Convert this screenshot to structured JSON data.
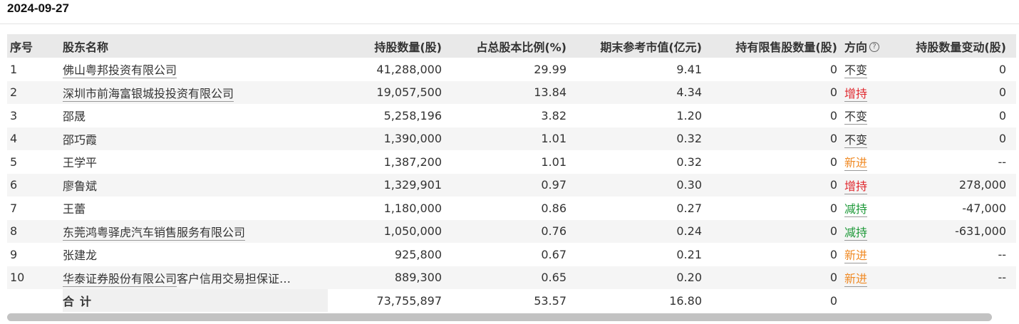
{
  "date": "2024-09-27",
  "headers": {
    "index": "序号",
    "name": "股东名称",
    "shares": "持股数量(股)",
    "ratio": "占总股本比例(%)",
    "market_value": "期末参考市值(亿元)",
    "restricted": "持有限售股数量(股)",
    "direction": "方向",
    "direction_help": "?",
    "change": "持股数量变动(股)"
  },
  "rows": [
    {
      "index": "1",
      "name": "佛山粤邦投资有限公司",
      "linked": true,
      "shares": "41,288,000",
      "ratio": "29.99",
      "market_value": "9.41",
      "restricted": "0",
      "direction": "不变",
      "dir_type": "same",
      "change": "0"
    },
    {
      "index": "2",
      "name": "深圳市前海富银城投投资有限公司",
      "linked": true,
      "shares": "19,057,500",
      "ratio": "13.84",
      "market_value": "4.34",
      "restricted": "0",
      "direction": "增持",
      "dir_type": "up",
      "change": "0"
    },
    {
      "index": "3",
      "name": "邵晟",
      "linked": false,
      "shares": "5,258,196",
      "ratio": "3.82",
      "market_value": "1.20",
      "restricted": "0",
      "direction": "不变",
      "dir_type": "same",
      "change": "0"
    },
    {
      "index": "4",
      "name": "邵巧霞",
      "linked": false,
      "shares": "1,390,000",
      "ratio": "1.01",
      "market_value": "0.32",
      "restricted": "0",
      "direction": "不变",
      "dir_type": "same",
      "change": "0"
    },
    {
      "index": "5",
      "name": "王学平",
      "linked": false,
      "shares": "1,387,200",
      "ratio": "1.01",
      "market_value": "0.32",
      "restricted": "0",
      "direction": "新进",
      "dir_type": "new",
      "change": "--"
    },
    {
      "index": "6",
      "name": "廖鲁斌",
      "linked": false,
      "shares": "1,329,901",
      "ratio": "0.97",
      "market_value": "0.30",
      "restricted": "0",
      "direction": "增持",
      "dir_type": "up",
      "change": "278,000"
    },
    {
      "index": "7",
      "name": "王蕾",
      "linked": false,
      "shares": "1,180,000",
      "ratio": "0.86",
      "market_value": "0.27",
      "restricted": "0",
      "direction": "减持",
      "dir_type": "down",
      "change": "-47,000"
    },
    {
      "index": "8",
      "name": "东莞鸿粤驿虎汽车销售服务有限公司",
      "linked": true,
      "shares": "1,050,000",
      "ratio": "0.76",
      "market_value": "0.24",
      "restricted": "0",
      "direction": "减持",
      "dir_type": "down",
      "change": "-631,000"
    },
    {
      "index": "9",
      "name": "张建龙",
      "linked": false,
      "shares": "925,800",
      "ratio": "0.67",
      "market_value": "0.21",
      "restricted": "0",
      "direction": "新进",
      "dir_type": "new",
      "change": "--"
    },
    {
      "index": "10",
      "name": "华泰证券股份有限公司",
      "name_suffix": "客户信用交易担保证…",
      "linked": true,
      "shares": "889,300",
      "ratio": "0.65",
      "market_value": "0.20",
      "restricted": "0",
      "direction": "新进",
      "dir_type": "new",
      "change": "--"
    }
  ],
  "total": {
    "label": "合计",
    "shares": "73,755,897",
    "ratio": "53.57",
    "market_value": "16.80",
    "restricted": "0"
  },
  "colors": {
    "up": "#e0282e",
    "down": "#1e9939",
    "new": "#f08a24",
    "same": "#333333",
    "header_bg": "#e9e9e9",
    "stripe_bg": "#f5f5f5"
  }
}
